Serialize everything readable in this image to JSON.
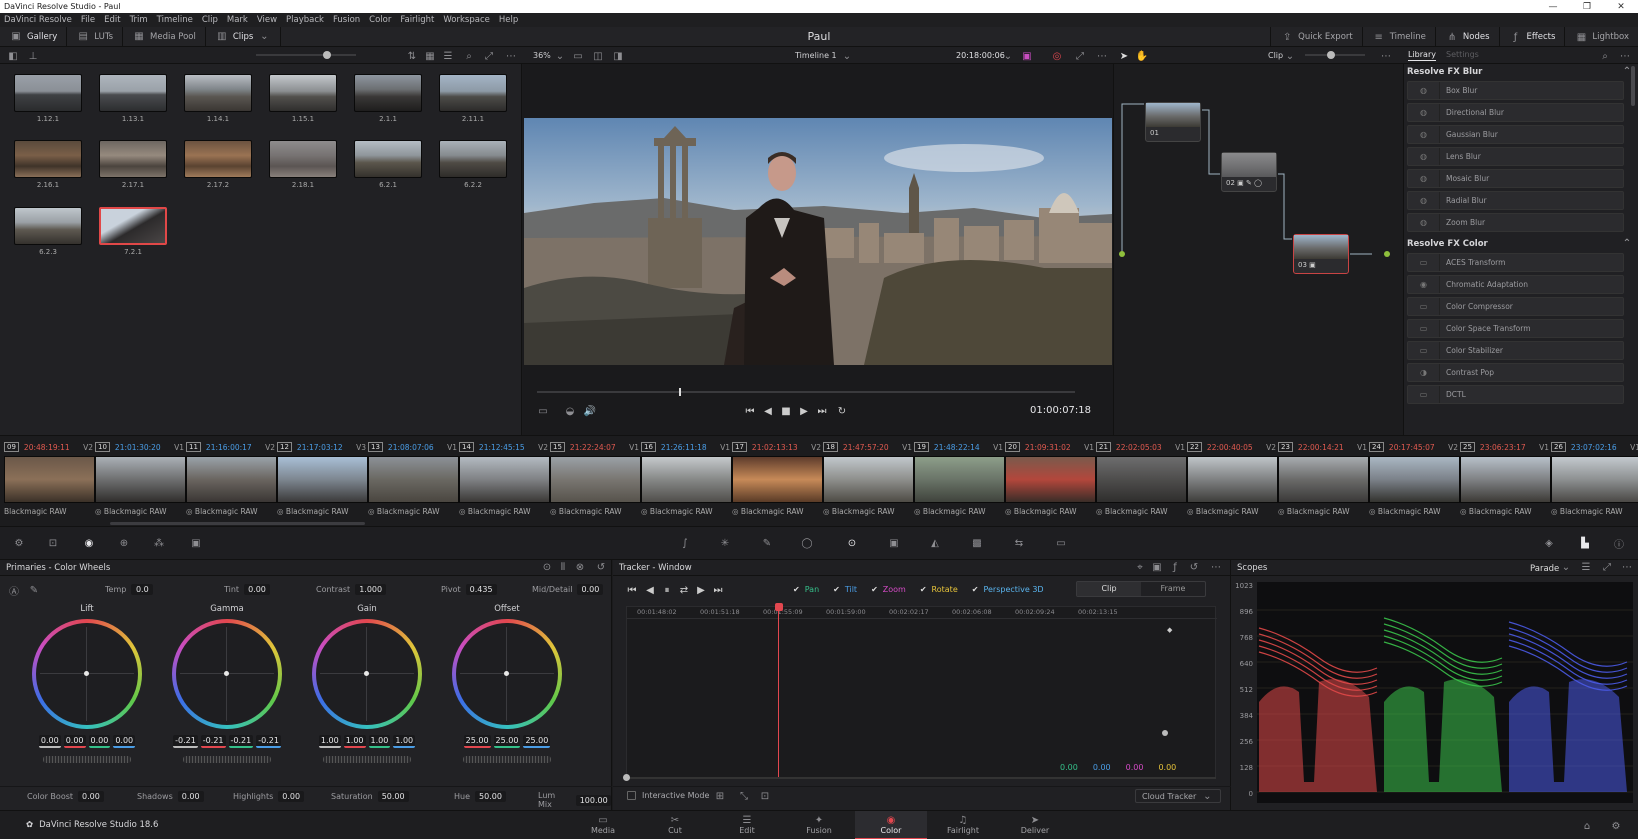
{
  "window": {
    "title": "DaVinci Resolve Studio - Paul",
    "controls": [
      "—",
      "❐",
      "✕"
    ]
  },
  "menu": [
    "DaVinci Resolve",
    "File",
    "Edit",
    "Trim",
    "Timeline",
    "Clip",
    "Mark",
    "View",
    "Playback",
    "Fusion",
    "Color",
    "Fairlight",
    "Workspace",
    "Help"
  ],
  "toolbar": {
    "left": [
      "Gallery",
      "LUTs",
      "Media Pool",
      "Clips"
    ],
    "project": "Paul",
    "right": [
      "Quick Export",
      "Timeline",
      "Nodes",
      "Effects",
      "Lightbox"
    ]
  },
  "subbar": {
    "zoom": "36%",
    "timeline": "Timeline 1",
    "timecode": "20:18:00:06",
    "node_mode": "Clip",
    "lib_tabs": [
      "Library",
      "Settings"
    ]
  },
  "gallery": {
    "stills": [
      "1.12.1",
      "1.13.1",
      "1.14.1",
      "1.15.1",
      "2.1.1",
      "2.11.1",
      "2.16.1",
      "2.17.1",
      "2.17.2",
      "2.18.1",
      "6.2.1",
      "6.2.2",
      "6.2.3",
      "7.2.1"
    ],
    "selected": "7.2.1"
  },
  "viewer": {
    "timecode": "01:00:07:18"
  },
  "nodes": {
    "labels": [
      "01",
      "02",
      "03"
    ]
  },
  "library": {
    "sections": [
      {
        "title": "Resolve FX Blur",
        "items": [
          "Box Blur",
          "Directional Blur",
          "Gaussian Blur",
          "Lens Blur",
          "Mosaic Blur",
          "Radial Blur",
          "Zoom Blur"
        ]
      },
      {
        "title": "Resolve FX Color",
        "items": [
          "ACES Transform",
          "Chromatic Adaptation",
          "Color Compressor",
          "Color Space Transform",
          "Color Stabilizer",
          "Contrast Pop",
          "DCTL"
        ]
      }
    ]
  },
  "clips": [
    {
      "num": "09",
      "tc": "20:48:19:11",
      "track": "V2",
      "color": "#e15a50",
      "codec": "Blackmagic RAW"
    },
    {
      "num": "10",
      "tc": "21:01:30:20",
      "track": "V1",
      "color": "#4a9de6",
      "codec": "Blackmagic RAW"
    },
    {
      "num": "11",
      "tc": "21:16:00:17",
      "track": "V2",
      "color": "#4a9de6",
      "codec": "Blackmagic RAW"
    },
    {
      "num": "12",
      "tc": "21:17:03:12",
      "track": "V3",
      "color": "#4a9de6",
      "codec": "Blackmagic RAW"
    },
    {
      "num": "13",
      "tc": "21:08:07:06",
      "track": "V1",
      "color": "#4a9de6",
      "codec": "Blackmagic RAW"
    },
    {
      "num": "14",
      "tc": "21:12:45:15",
      "track": "V2",
      "color": "#4a9de6",
      "codec": "Blackmagic RAW"
    },
    {
      "num": "15",
      "tc": "21:22:24:07",
      "track": "V1",
      "color": "#e15a50",
      "codec": "Blackmagic RAW"
    },
    {
      "num": "16",
      "tc": "21:26:11:18",
      "track": "V1",
      "color": "#4a9de6",
      "codec": "Blackmagic RAW"
    },
    {
      "num": "17",
      "tc": "21:02:13:13",
      "track": "V2",
      "color": "#e15a50",
      "codec": "Blackmagic RAW"
    },
    {
      "num": "18",
      "tc": "21:47:57:20",
      "track": "V1",
      "color": "#e15a50",
      "codec": "Blackmagic RAW"
    },
    {
      "num": "19",
      "tc": "21:48:22:14",
      "track": "V1",
      "color": "#4a9de6",
      "codec": "Blackmagic RAW"
    },
    {
      "num": "20",
      "tc": "21:09:31:02",
      "track": "V1",
      "color": "#e15a50",
      "codec": "Blackmagic RAW"
    },
    {
      "num": "21",
      "tc": "22:02:05:03",
      "track": "V1",
      "color": "#e15a50",
      "codec": "Blackmagic RAW"
    },
    {
      "num": "22",
      "tc": "22:00:40:05",
      "track": "V2",
      "color": "#e15a50",
      "codec": "Blackmagic RAW"
    },
    {
      "num": "23",
      "tc": "22:00:14:21",
      "track": "V1",
      "color": "#e15a50",
      "codec": "Blackmagic RAW"
    },
    {
      "num": "24",
      "tc": "20:17:45:07",
      "track": "V2",
      "color": "#e15a50",
      "codec": "Blackmagic RAW"
    },
    {
      "num": "25",
      "tc": "23:06:23:17",
      "track": "V1",
      "color": "#e15a50",
      "codec": "Blackmagic RAW"
    },
    {
      "num": "26",
      "tc": "23:07:02:16",
      "track": "V1",
      "color": "#4a9de6",
      "codec": "Blackmagic RAW"
    }
  ],
  "primaries": {
    "title": "Primaries - Color Wheels",
    "top_params": [
      {
        "label": "Temp",
        "value": "0.0"
      },
      {
        "label": "Tint",
        "value": "0.00"
      },
      {
        "label": "Contrast",
        "value": "1.000"
      },
      {
        "label": "Pivot",
        "value": "0.435"
      },
      {
        "label": "Mid/Detail",
        "value": "0.00"
      }
    ],
    "wheels": [
      {
        "name": "Lift",
        "values": [
          "0.00",
          "0.00",
          "0.00",
          "0.00"
        ]
      },
      {
        "name": "Gamma",
        "values": [
          "-0.21",
          "-0.21",
          "-0.21",
          "-0.21"
        ]
      },
      {
        "name": "Gain",
        "values": [
          "1.00",
          "1.00",
          "1.00",
          "1.00"
        ]
      },
      {
        "name": "Offset",
        "values": [
          "25.00",
          "25.00",
          "25.00"
        ]
      }
    ],
    "bottom_params": [
      {
        "label": "Color Boost",
        "value": "0.00"
      },
      {
        "label": "Shadows",
        "value": "0.00"
      },
      {
        "label": "Highlights",
        "value": "0.00"
      },
      {
        "label": "Saturation",
        "value": "50.00"
      },
      {
        "label": "Hue",
        "value": "50.00"
      },
      {
        "label": "Lum Mix",
        "value": "100.00"
      }
    ]
  },
  "tracker": {
    "title": "Tracker - Window",
    "checks": [
      {
        "label": "Pan",
        "color": "#35c08a"
      },
      {
        "label": "Tilt",
        "color": "#4a9de6"
      },
      {
        "label": "Zoom",
        "color": "#d64bc7"
      },
      {
        "label": "Rotate",
        "color": "#e6c33a"
      },
      {
        "label": "Perspective 3D",
        "color": "#5ab4ee"
      }
    ],
    "modes": [
      "Clip",
      "Frame"
    ],
    "ruler": [
      "00:01:48:02",
      "00:01:51:18",
      "00:01:55:09",
      "00:01:59:00",
      "00:02:02:17",
      "00:02:06:08",
      "00:02:09:24",
      "00:02:13:15"
    ],
    "readouts": [
      {
        "value": "0.00",
        "color": "#35c08a"
      },
      {
        "value": "0.00",
        "color": "#4a9de6"
      },
      {
        "value": "0.00",
        "color": "#d64bc7"
      },
      {
        "value": "0.00",
        "color": "#e6c33a"
      }
    ],
    "interactive": "Interactive Mode",
    "cloud": "Cloud Tracker"
  },
  "scopes": {
    "title": "Scopes",
    "mode": "Parade",
    "scale": [
      "1023",
      "896",
      "768",
      "640",
      "512",
      "384",
      "256",
      "128",
      "0"
    ]
  },
  "pages": [
    "Media",
    "Cut",
    "Edit",
    "Fusion",
    "Color",
    "Fairlight",
    "Deliver"
  ],
  "active_page": "Color",
  "app_version": "DaVinci Resolve Studio 18.6"
}
